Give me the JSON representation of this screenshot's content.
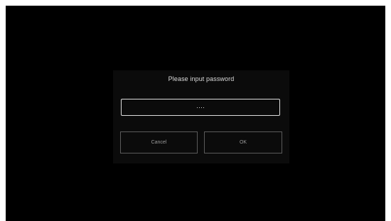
{
  "dialog": {
    "title": "Please input password",
    "password_value": "····",
    "cancel_label": "Cancel",
    "ok_label": "OK"
  },
  "colors": {
    "screen_background": "#000000",
    "dialog_background": "#0b0b0b",
    "field_border": "#dcdcdc",
    "button_border": "#5a5a5a"
  }
}
